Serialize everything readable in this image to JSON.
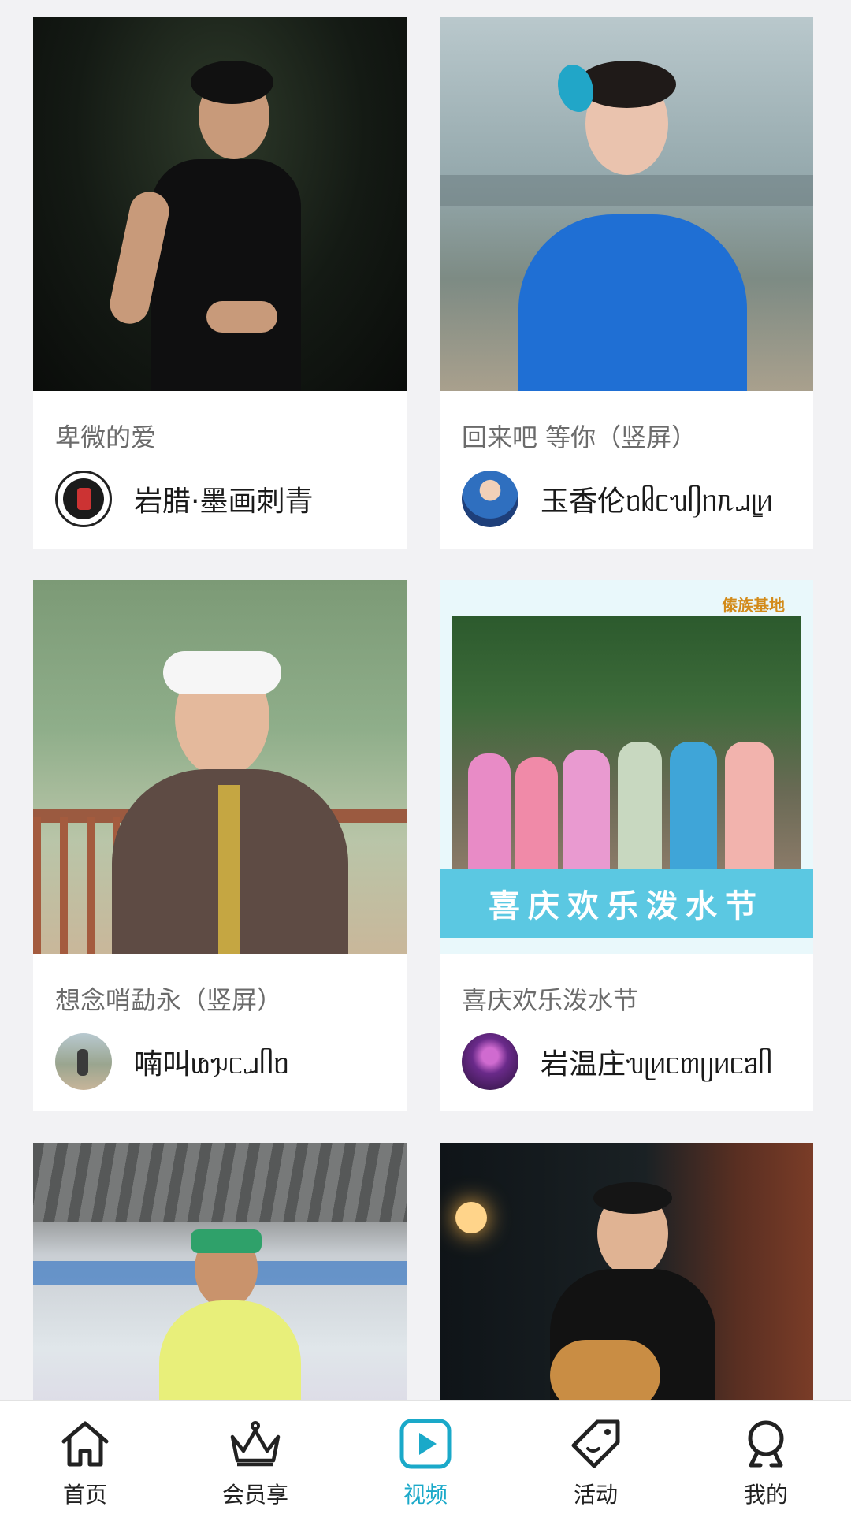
{
  "colors": {
    "accent": "#1aa9c9",
    "background": "#f2f2f4",
    "card": "#ffffff",
    "title_text": "#6b6b6b",
    "author_text": "#1a1a1a"
  },
  "videos": [
    {
      "title": "卑微的爱",
      "author": "岩腊·墨画刺青",
      "thumb": "man-black-tank-dark-forest",
      "avatar_icon": "calligraphy-logo-avatar"
    },
    {
      "title": "回来吧 等你（竖屏）",
      "author": "玉香伦ᥝᥤᥴᥔᥦᥒᥰᥘᥧᥢ",
      "thumb": "woman-blue-dress-bridge",
      "avatar_icon": "woman-portrait-avatar"
    },
    {
      "title": "想念哨勐永（竖屏）",
      "author": "喃叫ᥚᥭᥴᥘᥥᥝ",
      "thumb": "man-white-headband-lake",
      "avatar_icon": "outdoor-person-avatar"
    },
    {
      "title": "喜庆欢乐泼水节",
      "author": "岩温庄ᥔᥨᥢᥴᥖᥩᥢᥴᥑᥥ",
      "thumb": "group-photo-water-festival",
      "avatar_icon": "stage-performance-avatar",
      "overlay_text": "喜庆欢乐泼水节",
      "watermark": "傣族基地"
    },
    {
      "title": "",
      "author": "",
      "thumb": "man-green-headband-pavilion",
      "avatar_icon": ""
    },
    {
      "title": "",
      "author": "",
      "thumb": "man-playing-guitar-night",
      "avatar_icon": ""
    }
  ],
  "tabbar": {
    "items": [
      {
        "label": "首页",
        "icon": "home-icon"
      },
      {
        "label": "会员享",
        "icon": "crown-icon"
      },
      {
        "label": "视频",
        "icon": "video-play-icon",
        "active": true
      },
      {
        "label": "活动",
        "icon": "tag-icon"
      },
      {
        "label": "我的",
        "icon": "user-icon"
      }
    ]
  }
}
